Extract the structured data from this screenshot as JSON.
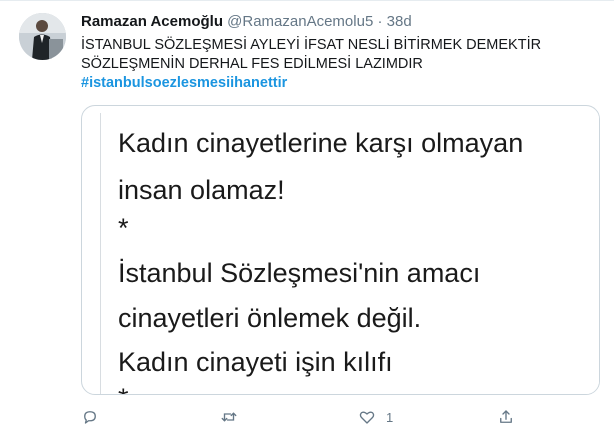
{
  "tweet": {
    "author_name": "Ramazan Acemoğlu",
    "handle": "@RamazanAcemolu5",
    "separator": "·",
    "time": "38d",
    "text_line1": "İSTANBUL SÖZLEŞMESİ AYLEYİ İFSAT NESLİ BİTİRMEK DEMEKTİR",
    "text_line2": "SÖZLEŞMENİN DERHAL FES EDİLMESİ LAZIMDIR",
    "hashtag": "#istanbulsoezlesmesiihanettir",
    "media_lines": [
      "Kadın cinayetlerine karşı olmayan",
      "insan olamaz!",
      "*",
      "İstanbul Sözleşmesi'nin amacı",
      "cinayetleri önlemek değil.",
      "Kadın cinayeti işin kılıfı",
      "*"
    ],
    "like_count": "1"
  },
  "icons": {
    "reply": "comment-bubble-icon",
    "retweet": "retweet-arrows-icon",
    "like": "heart-icon",
    "share": "share-upload-icon"
  },
  "colors": {
    "accent": "#1b95e0",
    "text": "#14171a",
    "muted": "#657786",
    "border": "#ccd6dd"
  }
}
